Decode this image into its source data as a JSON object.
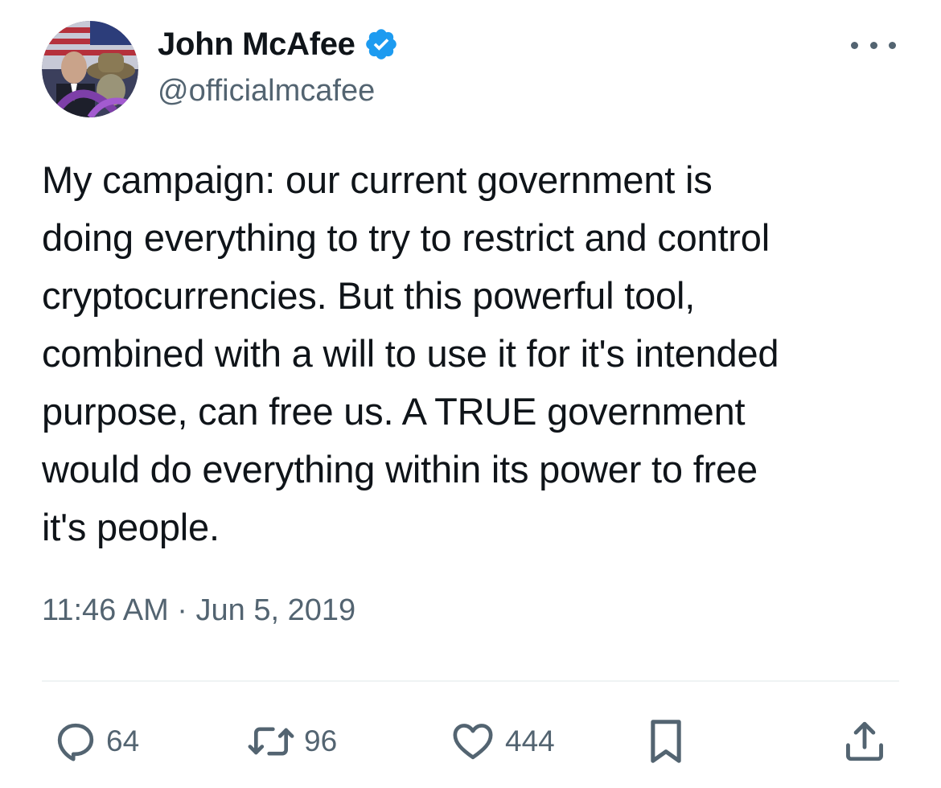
{
  "author": {
    "display_name": "John McAfee",
    "handle": "@officialmcafee",
    "verified": true,
    "verified_color": "#1d9bf0"
  },
  "tweet": {
    "text": "My campaign: our current government is\ndoing everything to try to restrict and control\ncryptocurrencies. But this powerful tool,\ncombined with a will to use it for it's intended\npurpose, can free us. A TRUE government\nwould do everything within its power to free\nit's people.",
    "timestamp": "11:46 AM · Jun 5, 2019"
  },
  "actions": {
    "reply": {
      "icon": "reply-icon",
      "count": "64"
    },
    "retweet": {
      "icon": "retweet-icon",
      "count": "96"
    },
    "like": {
      "icon": "heart-icon",
      "count": "444"
    },
    "bookmark": {
      "icon": "bookmark-icon"
    },
    "share": {
      "icon": "share-icon"
    }
  },
  "colors": {
    "text_primary": "#0f1419",
    "text_secondary": "#536471",
    "divider": "#eff3f4"
  }
}
